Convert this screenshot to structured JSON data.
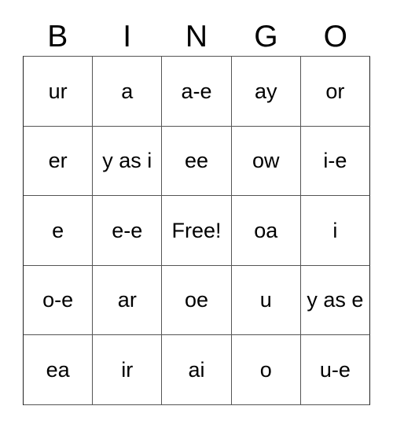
{
  "card": {
    "title": "BINGO",
    "columns": [
      "B",
      "I",
      "N",
      "G",
      "O"
    ],
    "free_space_label": "Free!",
    "colors": {
      "background": "#ffffff",
      "cell_background": "#ffffff",
      "grid_line": "#555555",
      "outer_border": "#222222",
      "text": "#000000"
    },
    "rows": [
      {
        "cells": [
          {
            "text": "ur"
          },
          {
            "text": "a"
          },
          {
            "text": "a-e"
          },
          {
            "text": "ay"
          },
          {
            "text": "or"
          }
        ]
      },
      {
        "cells": [
          {
            "text": "er"
          },
          {
            "text": "y as i"
          },
          {
            "text": "ee"
          },
          {
            "text": "ow"
          },
          {
            "text": "i-e"
          }
        ]
      },
      {
        "cells": [
          {
            "text": "e"
          },
          {
            "text": "e-e"
          },
          {
            "text": "Free!"
          },
          {
            "text": "oa"
          },
          {
            "text": "i"
          }
        ]
      },
      {
        "cells": [
          {
            "text": "o-e"
          },
          {
            "text": "ar"
          },
          {
            "text": "oe"
          },
          {
            "text": "u"
          },
          {
            "text": "y as e"
          }
        ]
      },
      {
        "cells": [
          {
            "text": "ea"
          },
          {
            "text": "ir"
          },
          {
            "text": "ai"
          },
          {
            "text": "o"
          },
          {
            "text": "u-e"
          }
        ]
      }
    ]
  }
}
